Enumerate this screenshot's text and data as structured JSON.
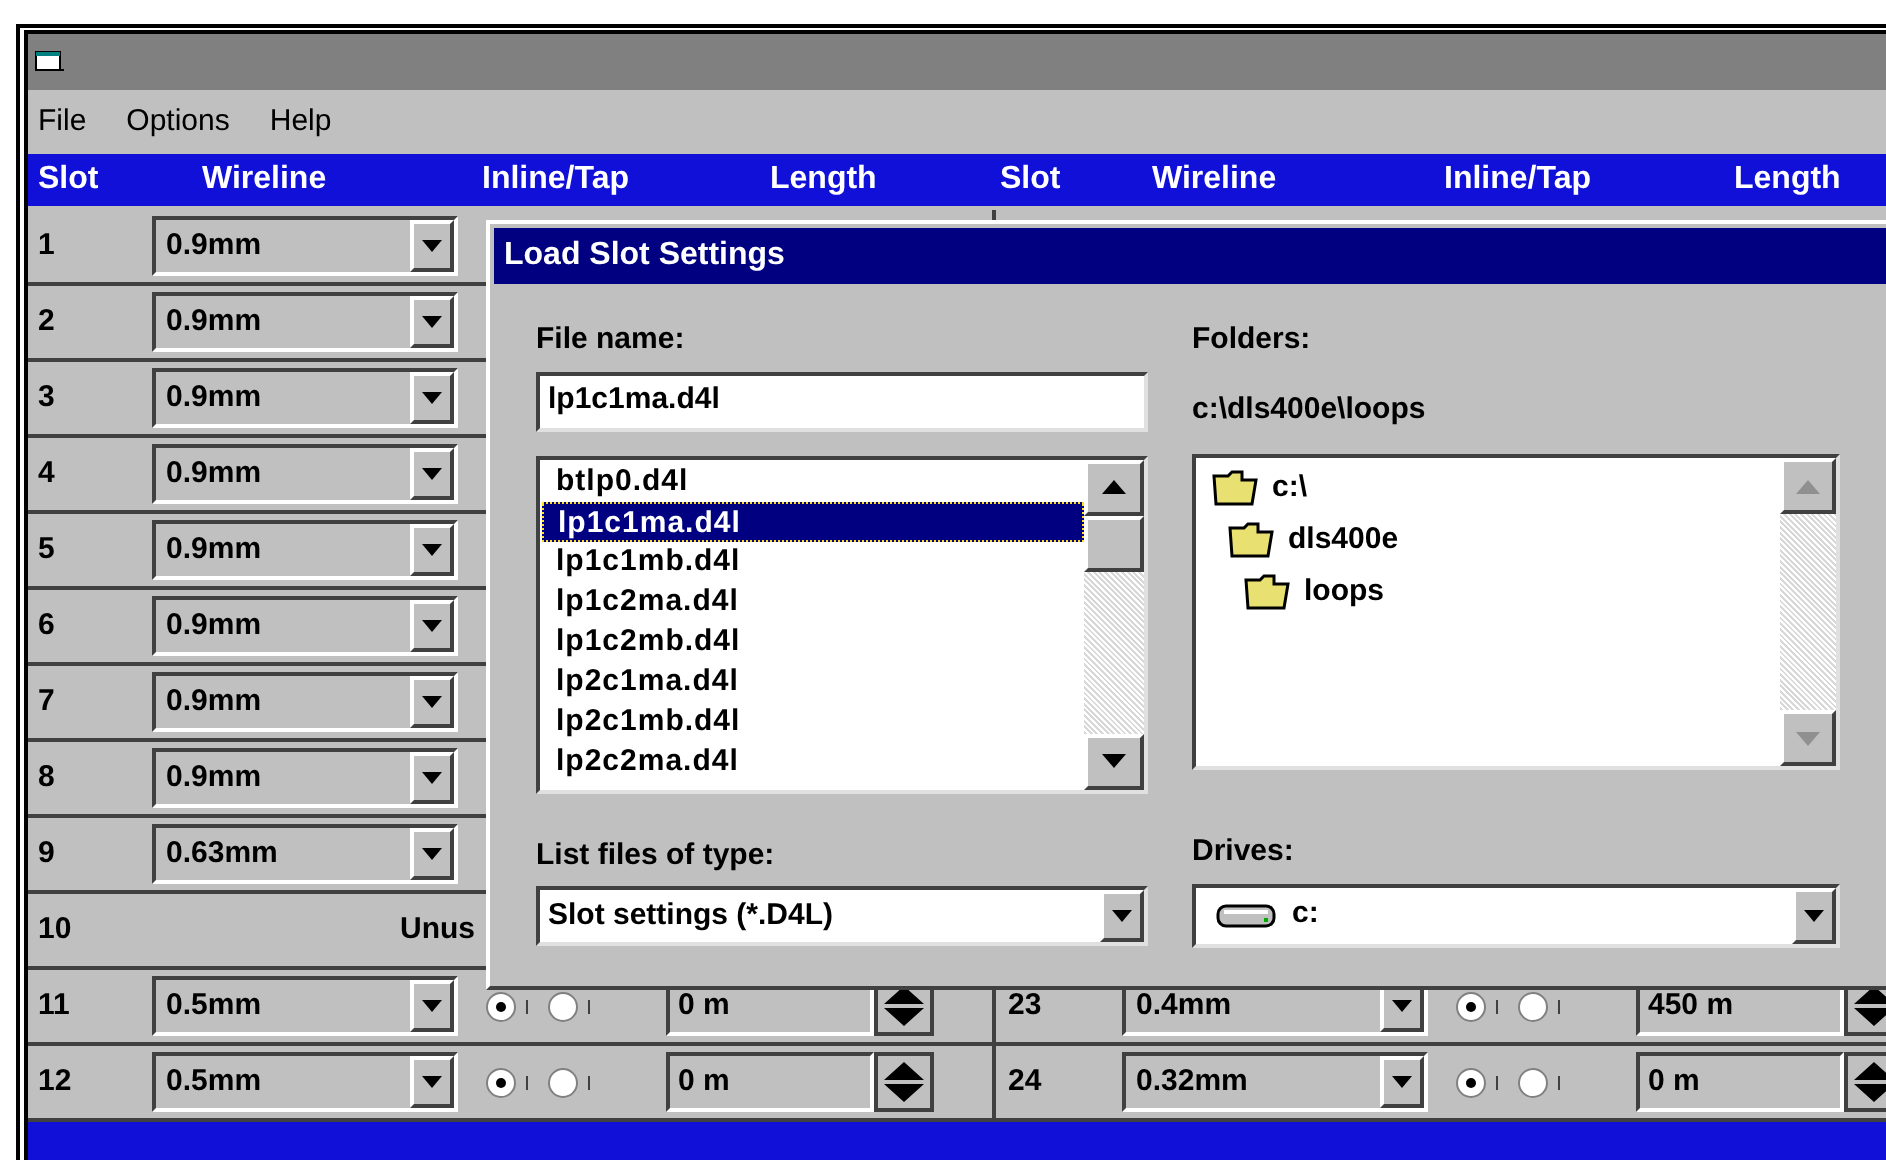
{
  "menu": [
    "File",
    "Options",
    "Help"
  ],
  "columns": [
    "Slot",
    "Wireline",
    "Inline/Tap",
    "Length",
    "Slot",
    "Wireline",
    "Inline/Tap",
    "Length"
  ],
  "rows": [
    {
      "left": {
        "kind": "combo",
        "slot": "1",
        "wireline": "0.9mm"
      }
    },
    {
      "left": {
        "kind": "combo",
        "slot": "2",
        "wireline": "0.9mm"
      }
    },
    {
      "left": {
        "kind": "combo",
        "slot": "3",
        "wireline": "0.9mm"
      }
    },
    {
      "left": {
        "kind": "combo",
        "slot": "4",
        "wireline": "0.9mm"
      }
    },
    {
      "left": {
        "kind": "combo",
        "slot": "5",
        "wireline": "0.9mm"
      }
    },
    {
      "left": {
        "kind": "combo",
        "slot": "6",
        "wireline": "0.9mm"
      }
    },
    {
      "left": {
        "kind": "combo",
        "slot": "7",
        "wireline": "0.9mm"
      }
    },
    {
      "left": {
        "kind": "combo",
        "slot": "8",
        "wireline": "0.9mm"
      }
    },
    {
      "left": {
        "kind": "combo",
        "slot": "9",
        "wireline": "0.63mm"
      }
    },
    {
      "left": {
        "kind": "unused",
        "slot": "10",
        "note": "Unus"
      }
    },
    {
      "left": {
        "kind": "full",
        "slot": "11",
        "wireline": "0.5mm",
        "radios": [
          {
            "selected": true
          },
          {
            "selected": false
          }
        ],
        "length": "0 m"
      },
      "right": {
        "kind": "full",
        "slot": "23",
        "wireline": "0.4mm",
        "radios": [
          {
            "selected": true
          },
          {
            "selected": false
          }
        ],
        "length": "450 m"
      }
    },
    {
      "left": {
        "kind": "full",
        "slot": "12",
        "wireline": "0.5mm",
        "radios": [
          {
            "selected": true
          },
          {
            "selected": false
          }
        ],
        "length": "0 m"
      },
      "right": {
        "kind": "full",
        "slot": "24",
        "wireline": "0.32mm",
        "radios": [
          {
            "selected": true
          },
          {
            "selected": false
          }
        ],
        "length": "0 m"
      }
    }
  ],
  "dialog": {
    "title": "Load Slot Settings",
    "file_name": {
      "label": "File name:",
      "value": "lp1c1ma.d4l"
    },
    "files": [
      {
        "name": "btlp0.d4l",
        "selected": false
      },
      {
        "name": "lp1c1ma.d4l",
        "selected": true
      },
      {
        "name": "lp1c1mb.d4l",
        "selected": false
      },
      {
        "name": "lp1c2ma.d4l",
        "selected": false
      },
      {
        "name": "lp1c2mb.d4l",
        "selected": false
      },
      {
        "name": "lp2c1ma.d4l",
        "selected": false
      },
      {
        "name": "lp2c1mb.d4l",
        "selected": false
      },
      {
        "name": "lp2c2ma.d4l",
        "selected": false
      }
    ],
    "folders": {
      "label": "Folders:",
      "path": "c:\\dls400e\\loops",
      "tree": [
        {
          "name": "c:\\",
          "children": [
            {
              "name": "dls400e",
              "children": [
                {
                  "name": "loops"
                }
              ]
            }
          ]
        }
      ]
    },
    "file_type": {
      "label": "List files of type:",
      "value": "Slot settings (*.D4L)"
    },
    "drives": {
      "label": "Drives:",
      "value": "c:"
    }
  }
}
